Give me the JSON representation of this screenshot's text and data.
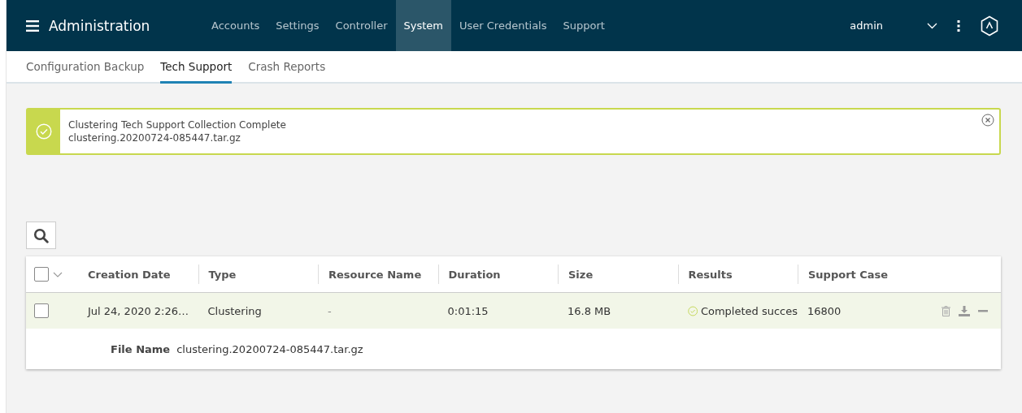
{
  "header": {
    "title": "Administration",
    "nav": [
      {
        "label": "Accounts",
        "selected": false
      },
      {
        "label": "Settings",
        "selected": false
      },
      {
        "label": "Controller",
        "selected": false
      },
      {
        "label": "System",
        "selected": true
      },
      {
        "label": "User Credentials",
        "selected": false
      },
      {
        "label": "Support",
        "selected": false
      }
    ],
    "user": "admin"
  },
  "subtabs": [
    {
      "label": "Configuration Backup",
      "selected": false
    },
    {
      "label": "Tech Support",
      "selected": true
    },
    {
      "label": "Crash Reports",
      "selected": false
    }
  ],
  "alert": {
    "title": "Clustering Tech Support Collection Complete",
    "message": "clustering.20200724-085447.tar.gz"
  },
  "table": {
    "select_all_checked": false,
    "columns": [
      "Creation Date",
      "Type",
      "Resource Name",
      "Duration",
      "Size",
      "Results",
      "Support Case"
    ],
    "rows": [
      {
        "checked": false,
        "expanded": true,
        "cells": [
          "Jul 24, 2020 2:26…",
          "Clustering",
          "-",
          "0:01:15",
          "16.8 MB",
          "Completed succes",
          "16800"
        ],
        "detail_label": "File Name",
        "detail_value": "clustering.20200724-085447.tar.gz"
      }
    ]
  }
}
